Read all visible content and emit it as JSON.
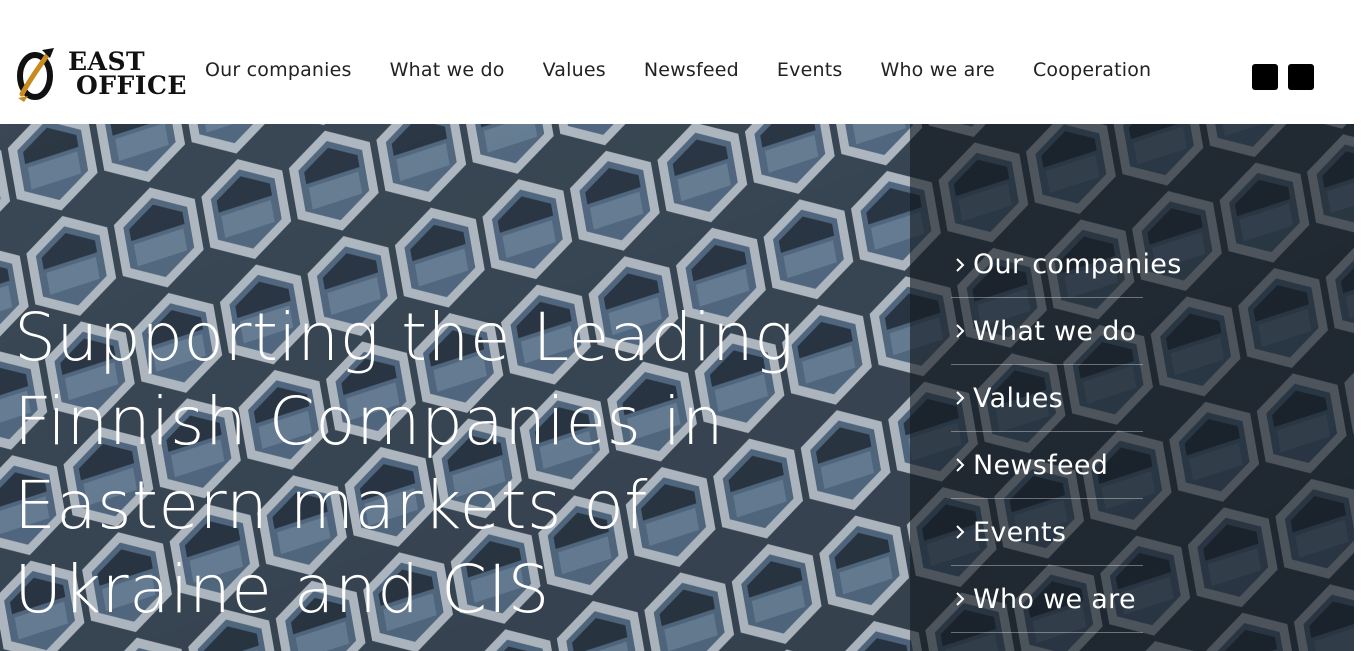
{
  "logo": {
    "line1": "EAST",
    "line2": "OFFICE",
    "icon": "east-office-logo-icon",
    "accent": "#c98a1e"
  },
  "nav": {
    "items": [
      {
        "label": "Our companies"
      },
      {
        "label": "What we do"
      },
      {
        "label": "Values"
      },
      {
        "label": "Newsfeed"
      },
      {
        "label": "Events"
      },
      {
        "label": "Who we are"
      },
      {
        "label": "Cooperation"
      }
    ]
  },
  "header_icons": [
    "square-icon",
    "square-icon"
  ],
  "hero": {
    "title": "Supporting the Leading Finnish Companies in Eastern markets of Ukraine and CIS",
    "background": "hexagon-facade-building-image",
    "overlay_color": "#141a21"
  },
  "side_menu": {
    "icon": "chevron-right-icon",
    "items": [
      {
        "label": "Our companies"
      },
      {
        "label": "What we do"
      },
      {
        "label": "Values"
      },
      {
        "label": "Newsfeed"
      },
      {
        "label": "Events"
      },
      {
        "label": "Who we are"
      }
    ]
  }
}
